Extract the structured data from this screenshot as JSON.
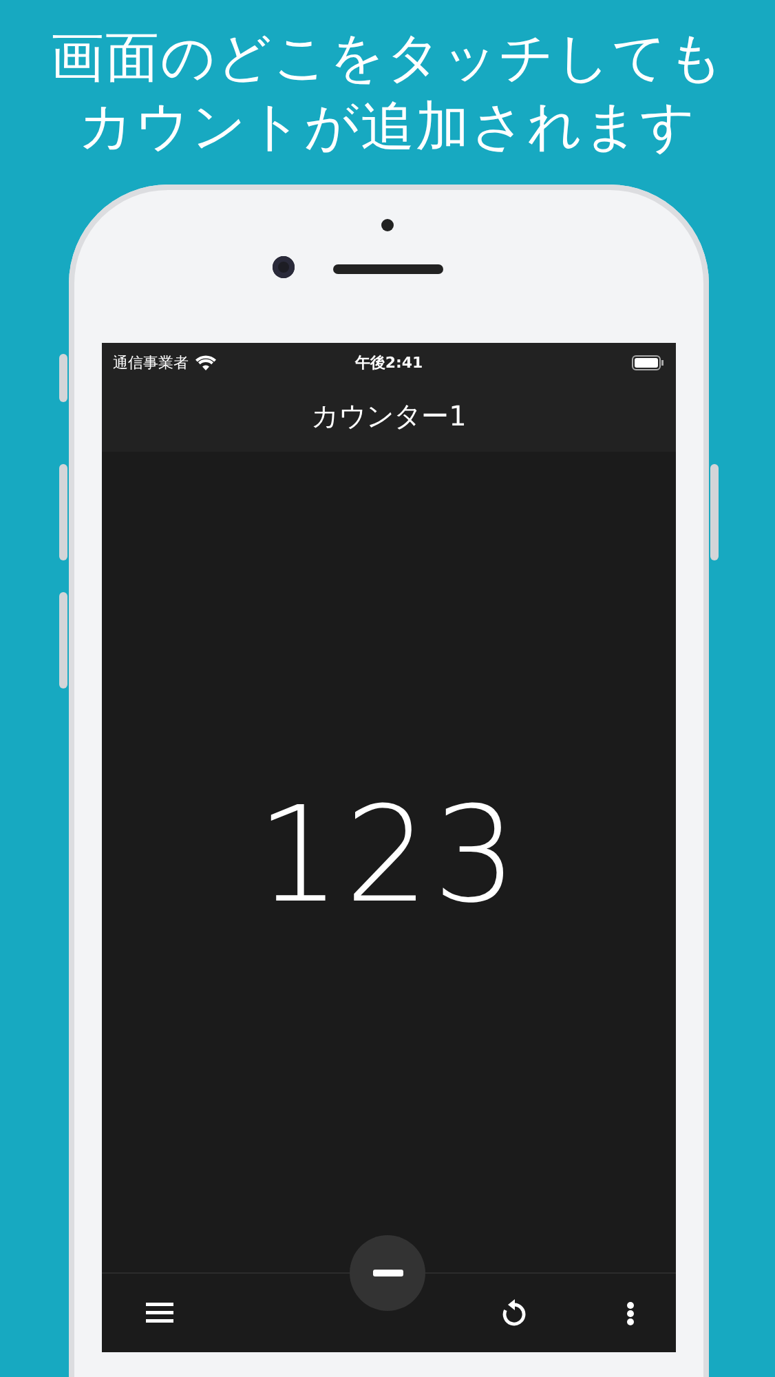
{
  "headline": [
    "画面のどこをタッチしても",
    "カウントが追加されます"
  ],
  "status_bar": {
    "carrier": "通信事業者",
    "time": "午後2:41"
  },
  "nav_bar": {
    "title": "カウンター1"
  },
  "counter": {
    "value": "123"
  }
}
